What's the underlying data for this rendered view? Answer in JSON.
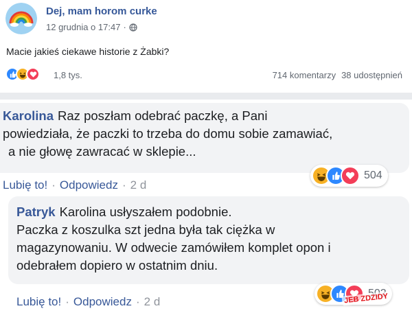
{
  "post": {
    "page_name": "Dej, mam horom curke",
    "timestamp": "12 grudnia o 17:47",
    "dot": "·",
    "globe_icon": "globe-icon",
    "text": "Macie jakieś ciekawe historie z Żabki?",
    "reactions": [
      "like-icon",
      "haha-icon",
      "love-icon"
    ],
    "reaction_count": "1,8 tys.",
    "comments_count": "714 komentarzy",
    "shares_count": "38 udostępnień"
  },
  "comments": [
    {
      "author": "Karolina",
      "line1": "Raz poszłam odebrać paczkę, a Pani",
      "line2": "powiedziała, że paczki to trzeba do domu sobie zamawiać,",
      "line3": "a nie głowę zawracać w sklepie...",
      "reactions": [
        "haha-icon",
        "like-icon",
        "love-icon"
      ],
      "reaction_count": "504",
      "like_label": "Lubię to!",
      "reply_label": "Odpowiedz",
      "time": "2 d",
      "sep": "·"
    },
    {
      "author": "Patryk",
      "line1": "Karolina  usłyszałem podobnie.",
      "line2": "Paczka z koszulka szt jedna była tak ciężka w",
      "line3": "magazynowaniu. W odwecie zamówiłem komplet opon i",
      "line4": "odebrałem dopiero w ostatnim dniu.",
      "reactions": [
        "haha-icon",
        "like-icon",
        "love-icon"
      ],
      "reaction_count": "502",
      "like_label": "Lubię to!",
      "reply_label": "Odpowiedz",
      "time": "2 d",
      "sep": "·"
    }
  ],
  "watermark": "JEB ZDZIDY",
  "colors": {
    "link": "#385898",
    "page_name": "#365899",
    "bubble": "#f2f3f5",
    "divider": "#e9ebee",
    "like": "#2d88ff",
    "haha": "#f7b125",
    "love": "#f33e58"
  }
}
